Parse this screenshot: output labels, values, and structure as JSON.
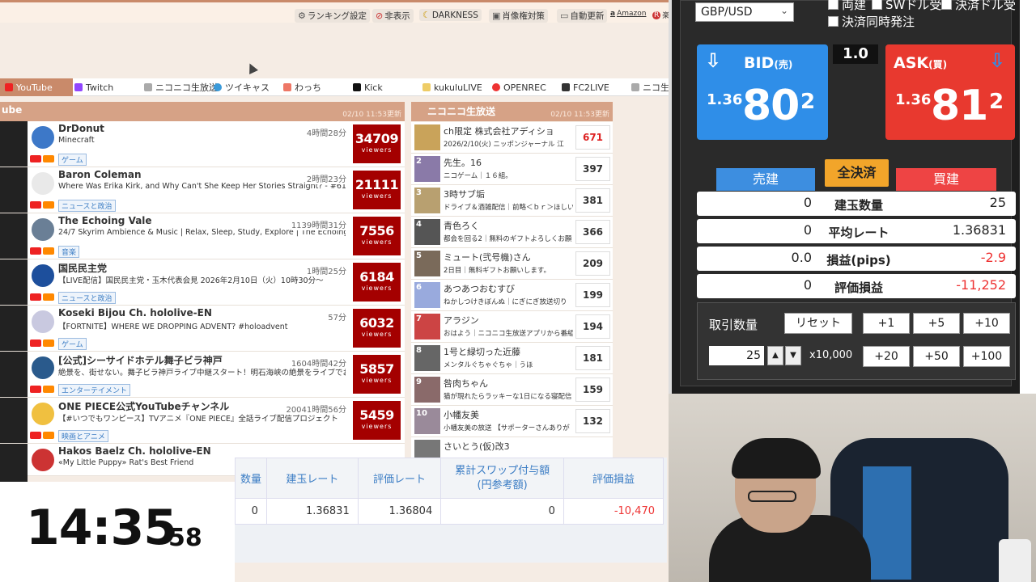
{
  "toolbar": {
    "items": [
      "ランキング設定",
      "非表示",
      "DARKNESS",
      "肖像権対策",
      "自動更新",
      "Amazon",
      "楽"
    ]
  },
  "tabs": [
    "YouTube",
    "Twitch",
    "ニコニコ生放送",
    "ツイキャス",
    "わっち",
    "Kick",
    "kukuluLIVE",
    "OPENREC",
    "FC2LIVE",
    "ニコ生公"
  ],
  "youtube": {
    "heading": "ube",
    "updated": "02/10 11:53更新",
    "rows": [
      {
        "name": "DrDonut",
        "title": "Minecraft",
        "time": "4時間28分",
        "category": "ゲーム",
        "viewers": "34709",
        "unit": "viewers"
      },
      {
        "name": "Baron Coleman",
        "title": "Where Was Erika Kirk, and Why Can't She Keep Her Stories Straight? - #61",
        "time": "2時間23分",
        "category": "ニュースと政治",
        "viewers": "21111",
        "unit": "viewers"
      },
      {
        "name": "The Echoing Vale",
        "title": "24/7 Skyrim Ambience & Music | Relax, Sleep, Study, Explore | The Echoing",
        "time": "1139時間31分",
        "category": "音楽",
        "viewers": "7556",
        "unit": "viewers"
      },
      {
        "name": "国民民主党",
        "title": "【LIVE配信】国民民主党・玉木代表会見 2026年2月10日（火）10時30分～",
        "time": "1時間25分",
        "category": "ニュースと政治",
        "viewers": "6184",
        "unit": "viewers"
      },
      {
        "name": "Koseki Bijou Ch. hololive-EN",
        "title": "【FORTNITE】WHERE WE DROPPING ADVENT? #holoadvent",
        "time": "57分",
        "category": "ゲーム",
        "viewers": "6032",
        "unit": "viewers"
      },
      {
        "name": "[公式]シーサイドホテル舞子ビラ神戸",
        "title": "絶景を、街せない。舞子ビラ神戸ライブ中継スタート！明石海峡の絶景をライブでお楽し",
        "time": "1604時間42分",
        "category": "エンターテイメント",
        "viewers": "5857",
        "unit": "viewers"
      },
      {
        "name": "ONE PIECE公式YouTubeチャンネル",
        "title": "【#いつでもワンピース】TVアニメ『ONE PIECE』全話ライブ配信プロジェクト",
        "time": "20041時間56分",
        "category": "映画とアニメ",
        "viewers": "5459",
        "unit": "viewers"
      },
      {
        "name": "Hakos Baelz Ch. hololive-EN",
        "title": "«My Little Puppy» Rat's Best Friend",
        "time": "",
        "category": "",
        "viewers": "",
        "unit": ""
      }
    ]
  },
  "nico": {
    "heading": "ニコニコ生放送",
    "updated": "02/10 11:53更新",
    "rows": [
      {
        "rank": "",
        "name": "ch限定 株式会社アディショ",
        "desc": "2026/2/10(火) ニッポンジャーナル 江",
        "count": "671"
      },
      {
        "rank": "2",
        "name": "先生。16",
        "desc": "ニコゲーム｜１６組。",
        "count": "397"
      },
      {
        "rank": "3",
        "name": "3時サブ垢",
        "desc": "ドライブ＆酒雑配信｜前略＜ｂｒ＞ほしい",
        "count": "381"
      },
      {
        "rank": "4",
        "name": "青色ろく",
        "desc": "都会を回る2｜無料のギフトよろしくお願",
        "count": "366"
      },
      {
        "rank": "5",
        "name": "ミュート(弐号機)さん",
        "desc": "2日目｜無料ギフトお願いします。",
        "count": "209"
      },
      {
        "rank": "6",
        "name": "あつあつおむすび",
        "desc": "ねかしつけきぼんぬ｜にぎにぎ放送切り",
        "count": "199"
      },
      {
        "rank": "7",
        "name": "アラジン",
        "desc": "おはよう｜ニコニコ生放送アプリから番組",
        "count": "194"
      },
      {
        "rank": "8",
        "name": "1号と緑切った近藤",
        "desc": "メンタルぐちゃぐちゃ｜うほ",
        "count": "181"
      },
      {
        "rank": "9",
        "name": "咎肉ちゃん",
        "desc": "猫が現れたらラッキーな1日になる寝配信",
        "count": "159"
      },
      {
        "rank": "10",
        "name": "小幡友美",
        "desc": "小幡友美の放送 【サポーターさんありが",
        "count": "132"
      },
      {
        "rank": "",
        "name": "さいとう(仮)改3",
        "desc": "",
        "count": ""
      }
    ]
  },
  "positions": {
    "headers": [
      "数量",
      "建玉レート",
      "評価レート",
      "累計スワップ付与額",
      "(円参考額)",
      "評価損益"
    ],
    "row": {
      "qty": "0",
      "open_rate": "1.36831",
      "eval_rate": "1.36804",
      "swap": "0",
      "pl": "-10,470"
    }
  },
  "clock": {
    "hm": "14:35",
    "sec": "58"
  },
  "trade": {
    "pair": "GBP/USD",
    "checks": [
      "両建",
      "SWドル受",
      "決済ドル受",
      "決済同時発注"
    ],
    "spread": "1.0",
    "bid": {
      "label": "BID",
      "sub": "(売)",
      "pre": "1.36",
      "big": "80",
      "sup": "2"
    },
    "ask": {
      "label": "ASK",
      "sub": "(買)",
      "pre": "1.36",
      "big": "81",
      "sup": "2"
    },
    "sell_label": "売建",
    "close_all_label": "全決済",
    "buy_label": "買建",
    "stats": [
      {
        "left": "0",
        "label": "建玉数量",
        "right": "25",
        "neg": false
      },
      {
        "left": "0",
        "label": "平均レート",
        "right": "1.36831",
        "neg": false
      },
      {
        "left": "0.0",
        "label": "損益(pips)",
        "right": "-2.9",
        "neg": true
      },
      {
        "left": "0",
        "label": "評価損益",
        "right": "-11,252",
        "neg": true
      }
    ],
    "qty_label": "取引数量",
    "reset_label": "リセット",
    "qty_buttons": [
      "+1",
      "+5",
      "+10",
      "+20",
      "+50",
      "+100"
    ],
    "qty_value": "25",
    "multiplier": "x10,000",
    "colors": {
      "bid": "#2f8ee8",
      "ask": "#e8392f",
      "close_all": "#f2a52a"
    }
  }
}
